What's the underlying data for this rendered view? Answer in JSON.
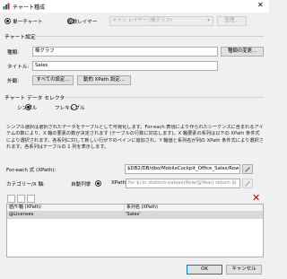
{
  "window": {
    "title": "チャート種成",
    "close": "✕"
  },
  "mode": {
    "single_chart": "単一チャート",
    "multi_layer": "複数レイヤー",
    "layer_select": "メイン レイヤー (棒グラフ)",
    "manage_button": "管理..."
  },
  "chart_settings": {
    "section": "チャート設定",
    "type_label": "種類:",
    "type_value": "棒グラフ",
    "change_type_button": "種類の変更...",
    "title_label": "タイトル:",
    "title_value": "Sales",
    "appearance_label": "外観:",
    "all_settings_button": "すべての設定...",
    "dynamic_xpath_button": "動的 XPath 設定..."
  },
  "selector": {
    "section": "チャート データ セレクター",
    "simple": "シンプル",
    "flexible": "フレキシブル",
    "description": "シンプル選択は選択されたデータをテーブルとして可視化します。For-each 表現により作られたシーケンスに含まれるアイテムの数により、X 軸の要素の数が決定されます (テーブルの行数に対応します)。X 軸要素の系列は以下の XPath 条件式により選択されます。各系列に対して新しい行が下のペインに追加され、Y 軸値と系列名が列の XPath 条件式により選択されます。各系列はテーブルの 1 列を表示します。",
    "foreach_label": "For-each 式 (XPath):",
    "foreach_value": "$DB2/DB/dbo/MobileCockpit_Office_Sales/Row",
    "category_label": "カテゴリー/X 軸:",
    "auto_sequence": "自動列挙",
    "xpath_option": "XPath",
    "xpath_value": "for $i in distinct-values(Row/@Year) return $i"
  },
  "grid": {
    "col1": "値/Y-軸 (XPath)",
    "col2": "系列名 (XPath)",
    "rows": [
      {
        "value": "@Licenses",
        "name": "'Sales'"
      }
    ]
  },
  "footer": {
    "ok": "OK",
    "cancel": "キャンセル"
  },
  "colors": {
    "accent": "#0078d7",
    "delete": "#c00000"
  }
}
